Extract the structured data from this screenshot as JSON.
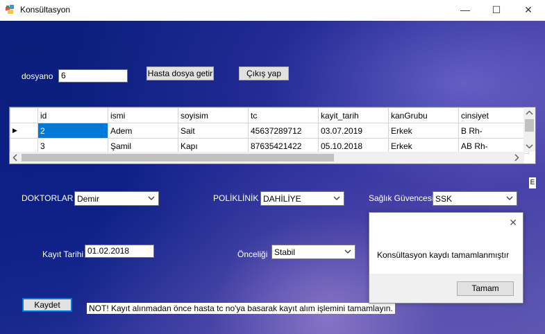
{
  "window": {
    "title": "Konsültasyon",
    "controls": {
      "minimize": "—",
      "maximize": "☐",
      "close": "✕"
    }
  },
  "form": {
    "dosyano_label": "dosyano",
    "dosyano_value": "6",
    "get_file_button": "Hasta dosya getir",
    "exit_button": "Çıkış yap"
  },
  "grid": {
    "columns": [
      "id",
      "ismi",
      "soyisim",
      "tc",
      "kayit_tarih",
      "kanGrubu",
      "cinsiyet"
    ],
    "rows": [
      [
        "2",
        "Adem",
        "Sait",
        "45637289712",
        "03.07.2019",
        "Erkek",
        "B Rh-"
      ],
      [
        "3",
        "Şamil",
        "Kapı",
        "87635421422",
        "05.10.2018",
        "Erkek",
        "AB Rh-"
      ]
    ],
    "current_row_marker": "▶"
  },
  "doctors": {
    "label": "DOKTORLAR",
    "value": "Demir"
  },
  "clinic": {
    "label": "POLİKLİNİK",
    "value": "DAHİLİYE"
  },
  "insurance": {
    "label": "Sağlık Güvencesi",
    "value": "SSK"
  },
  "date": {
    "label": "Kayıt Tarihi",
    "value": "01.02.2018"
  },
  "priority": {
    "label": "Önceliği",
    "value": "Stabil"
  },
  "save_button": "Kaydet",
  "note_text": "NOT! Kayıt alınmadan önce hasta tc no'ya basarak kayıt alım işlemini tamamlayın.",
  "dialog": {
    "message": "Konsültasyon kaydı tamamlanmıştır",
    "ok_button": "Tamam",
    "close_glyph": "✕"
  },
  "side_marker": "E",
  "colors": {
    "selection": "#0078d7",
    "accent_blue": "#0b1f86"
  }
}
